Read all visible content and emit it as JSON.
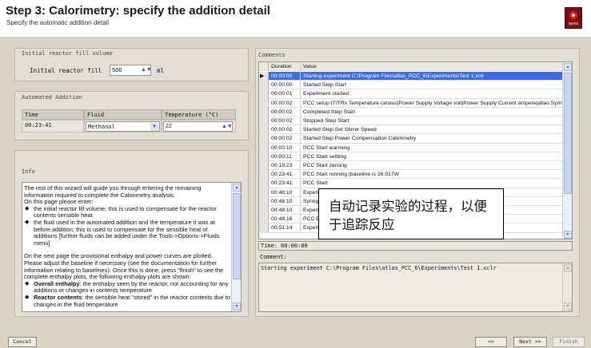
{
  "header": {
    "title": "Step 3: Calorimetry: specify the addition detail",
    "subtitle": "Specify the automatic addition detail",
    "logo_text": "syrris"
  },
  "initial_reactor": {
    "section_title": "Initial reactor fill volume",
    "label": "Initial reactor fill",
    "value": "500",
    "unit": "ml"
  },
  "automated_addition": {
    "section_title": "Automated Addition",
    "columns": [
      "Time",
      "Fluid",
      "Temperature (°C)"
    ],
    "row": {
      "time": "00:23:41",
      "fluid": "Methanol",
      "temperature": "22"
    }
  },
  "info": {
    "section_title": "Info",
    "paragraph1": "The rest of this wizard will guide you through entering the remaining information required to complete the Calorimetry analysis.",
    "paragraph2": "On this page please enter:",
    "bullets1": [
      "the initial reactor fill volume; this is used to compensate for the reactor contents sensible heat",
      "the fluid used in the automated addition and the temperature it was at before addition; this is used to compensate for the sensible heat of additions [further fluids can be added under the Tools->Options->Fluids menu]"
    ],
    "paragraph3": "On the next page the provisional enthalpy and power curves are plotted. Please adjust the baseline if necessary (see the documentation for further information relating to baselines). Once this is done, press \"finish\" to see the complete enthalpy plots, the following enthalpy plots are shown:",
    "bullets2": [
      {
        "bold": "Overall enthalpy",
        "text": ": the enthalpy seen by the reactor, not accounting for any additions or changes in contents temperature"
      },
      {
        "bold": "Reactor contents",
        "text": ": the sensible heat \"stored\" in the reactor contents due to changes in the fluid temperature"
      }
    ]
  },
  "comments": {
    "section_title": "Comments",
    "columns": [
      "Duration",
      "Value"
    ],
    "rows": [
      {
        "duration": "00:00:00",
        "value": "Starting experiment C:\\Program Files\\atlas_PCC_6\\Experiments\\Test 1.xclr",
        "selected": true
      },
      {
        "duration": "00:00:00",
        "value": "Started Step Start"
      },
      {
        "duration": "00:00:01",
        "value": "Experiment started"
      },
      {
        "duration": "00:00:02",
        "value": "PCC setup IT/TRx Temperature celsius|Power Supply Voltage volt|Power Supply Current ampere|atlas Syrin..."
      },
      {
        "duration": "00:00:02",
        "value": "Completed Step Start"
      },
      {
        "duration": "00:00:02",
        "value": "Stopped Step Start"
      },
      {
        "duration": "00:00:02",
        "value": "Started Step Set Stirrer Speed"
      },
      {
        "duration": "00:00:02",
        "value": "Started Step Power Compensation Calorimetry"
      },
      {
        "duration": "00:00:10",
        "value": "PCC Start warming"
      },
      {
        "duration": "00:00:11",
        "value": "PCC Start settling"
      },
      {
        "duration": "00:19:23",
        "value": "PCC Start zeroing"
      },
      {
        "duration": "00:23:41",
        "value": "PCC Start running |baseline is 26.917W"
      },
      {
        "duration": "00:23:41",
        "value": "PCC Start"
      },
      {
        "duration": "00:48:10",
        "value": "Experimen"
      },
      {
        "duration": "00:48:10",
        "value": "Syringe pu"
      },
      {
        "duration": "00:48:10",
        "value": "Experimen"
      },
      {
        "duration": "00:48:16",
        "value": "PCC End t"
      },
      {
        "duration": "00:51:14",
        "value": "Experimen"
      }
    ],
    "time_label": "Time:",
    "time_value": "00:00:00",
    "comment_label": "Comment:",
    "comment_value": "Starting experiment C:\\Program Files\\atlas_PCC_6\\Experiments\\Test 1.xclr"
  },
  "callout": {
    "text": "自动记录实验的过程，以便于追踪反应"
  },
  "buttons": {
    "cancel": "Cancel",
    "back": "<<",
    "next": "Next >>",
    "finish": "Finish"
  },
  "colors": {
    "selection": "#3e6fd6",
    "window_bg": "#d9d4c8"
  }
}
